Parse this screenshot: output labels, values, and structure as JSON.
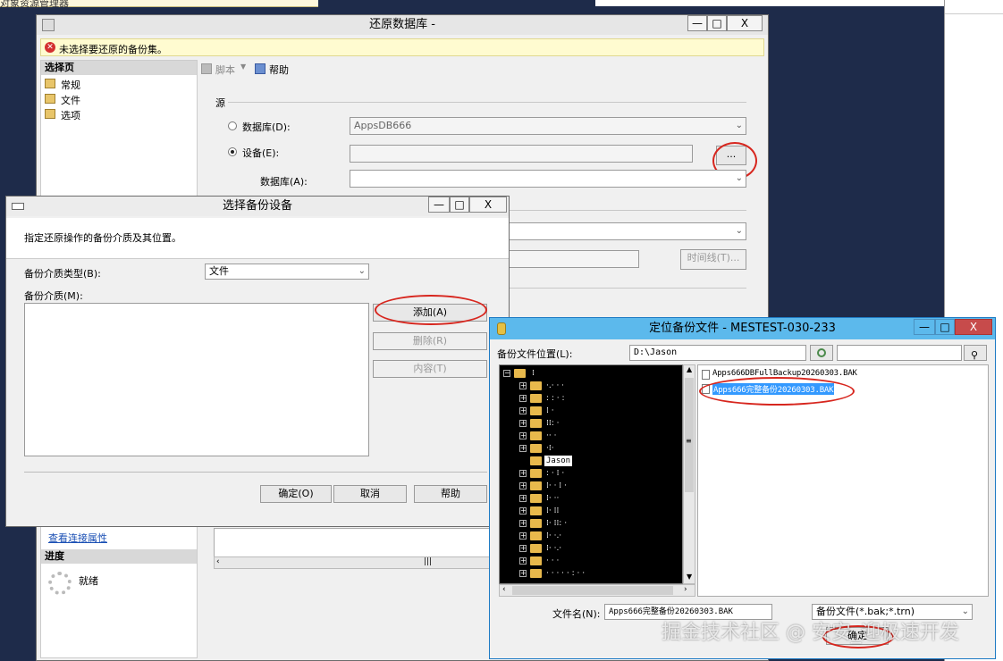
{
  "background": {
    "top_left_window_title": "对象资源管理器"
  },
  "restore_window": {
    "title": "还原数据库 -",
    "controls": {
      "minimize": "—",
      "maximize": "□",
      "close": "X"
    },
    "error_message": "未选择要还原的备份集。",
    "left_panel": {
      "header": "选择页",
      "items": [
        "常规",
        "文件",
        "选项"
      ],
      "connection_link": "查看连接属性",
      "progress_header": "进度",
      "progress_status": "就绪"
    },
    "toolbar": {
      "script_label": "脚本",
      "help_label": "帮助"
    },
    "source": {
      "section_label": "源",
      "database_radio_label": "数据库(D):",
      "database_value": "AppsDB666",
      "device_radio_label": "设备(E):",
      "device_value": "",
      "browse_button": "...",
      "target_database_label": "数据库(A):",
      "target_database_value": "",
      "timeline_button": "时间线(T)..."
    }
  },
  "backup_device_dialog": {
    "title": "选择备份设备",
    "controls": {
      "minimize": "—",
      "maximize": "□",
      "close": "X"
    },
    "description": "指定还原操作的备份介质及其位置。",
    "media_type_label": "备份介质类型(B):",
    "media_type_value": "文件",
    "media_label": "备份介质(M):",
    "add_button": "添加(A)",
    "remove_button": "删除(R)",
    "contents_button": "内容(T)",
    "ok_button": "确定(O)",
    "cancel_button": "取消",
    "help_button": "帮助"
  },
  "locate_backup_dialog": {
    "title": "定位备份文件 - MESTEST-030-233",
    "controls": {
      "minimize": "—",
      "maximize": "□",
      "close": "X"
    },
    "path_label": "备份文件位置(L):",
    "path_value": "D:\\Jason",
    "selected_folder": "Jason",
    "files": [
      "Apps666DBFullBackup20260303.BAK",
      "Apps666完整备份20260303.BAK"
    ],
    "filename_label": "文件名(N):",
    "filename_value": "Apps666完整备份20260303.BAK",
    "filetype_value": "备份文件(*.bak;*.trn)",
    "ok_button": "确定"
  },
  "watermark": "掘金技术社区 @ 安安_迎极速开发"
}
